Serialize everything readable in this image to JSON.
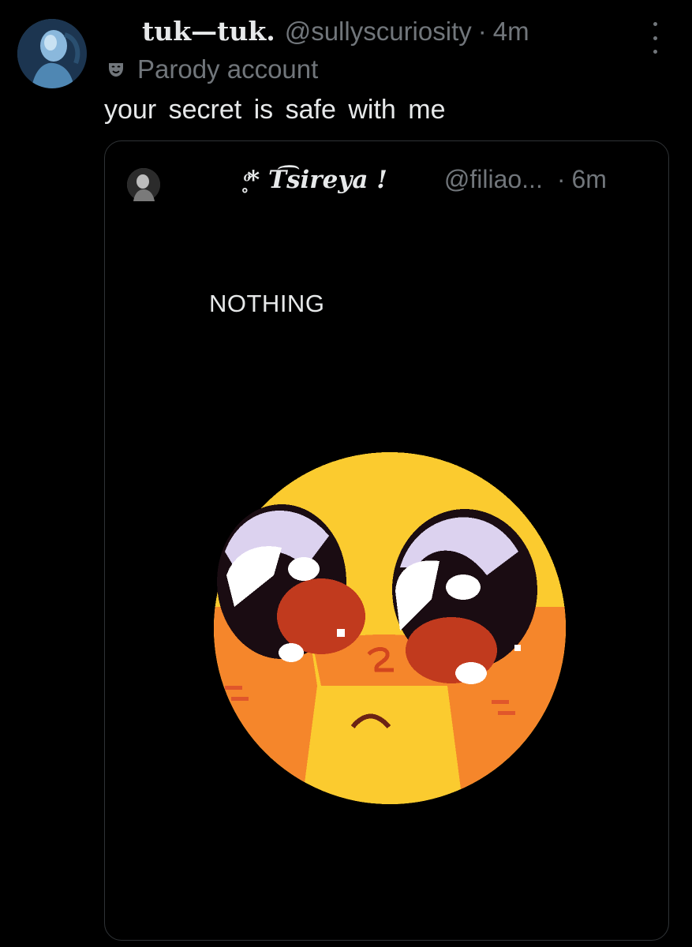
{
  "tweet": {
    "display_name": "tuk—tuk.",
    "handle": "@sullyscuriosity",
    "separator": "·",
    "time": "4m",
    "label": "Parody account",
    "text": "your secret is safe with me"
  },
  "quoted": {
    "display_name": "̥ͦ* T͡sireya !",
    "handle": "@filiao...",
    "separator": "·",
    "time": "6m",
    "text": "NOTHING"
  },
  "icons": {
    "more": "more-vertical-icon",
    "parody": "theater-mask-icon",
    "media": "pleading-face-emoji"
  },
  "colors": {
    "background": "#000000",
    "text_primary": "#e7e9ea",
    "text_secondary": "#71767b",
    "card_border": "#2f3336"
  }
}
